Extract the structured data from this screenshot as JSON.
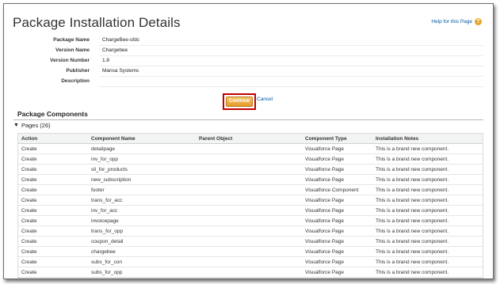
{
  "page": {
    "title": "Package Installation Details",
    "help_link": "Help for this Page"
  },
  "details": [
    {
      "label": "Package Name",
      "value": "ChargeBee-sfdc"
    },
    {
      "label": "Version Name",
      "value": "Chargebee"
    },
    {
      "label": "Version Number",
      "value": "1.8"
    },
    {
      "label": "Publisher",
      "value": "Mansa Systems"
    },
    {
      "label": "Description",
      "value": ""
    }
  ],
  "actions": {
    "continue_label": "Continue",
    "cancel_label": "Cancel"
  },
  "components": {
    "section_title": "Package Components",
    "group_label": "Pages (26)",
    "columns": [
      "Action",
      "Component Name",
      "Parent Object",
      "Component Type",
      "Installation Notes"
    ],
    "rows": [
      [
        "Create",
        "detailpage",
        "",
        "Visualforce Page",
        "This is a brand new component."
      ],
      [
        "Create",
        "inv_for_opp",
        "",
        "Visualforce Page",
        "This is a brand new component."
      ],
      [
        "Create",
        "sli_for_products",
        "",
        "Visualforce Page",
        "This is a brand new component."
      ],
      [
        "Create",
        "new_subscription",
        "",
        "Visualforce Page",
        "This is a brand new component."
      ],
      [
        "Create",
        "footer",
        "",
        "Visualforce Component",
        "This is a brand new component."
      ],
      [
        "Create",
        "trans_for_acc",
        "",
        "Visualforce Page",
        "This is a brand new component."
      ],
      [
        "Create",
        "inv_for_acc",
        "",
        "Visualforce Page",
        "This is a brand new component."
      ],
      [
        "Create",
        "invoicepage",
        "",
        "Visualforce Page",
        "This is a brand new component."
      ],
      [
        "Create",
        "trans_for_opp",
        "",
        "Visualforce Page",
        "This is a brand new component."
      ],
      [
        "Create",
        "coupon_detail",
        "",
        "Visualforce Page",
        "This is a brand new component."
      ],
      [
        "Create",
        "chargebee",
        "",
        "Visualforce Page",
        "This is a brand new component."
      ],
      [
        "Create",
        "subs_for_con",
        "",
        "Visualforce Page",
        "This is a brand new component."
      ],
      [
        "Create",
        "subs_for_opp",
        "",
        "Visualforce Page",
        "This is a brand new component."
      ]
    ]
  }
}
